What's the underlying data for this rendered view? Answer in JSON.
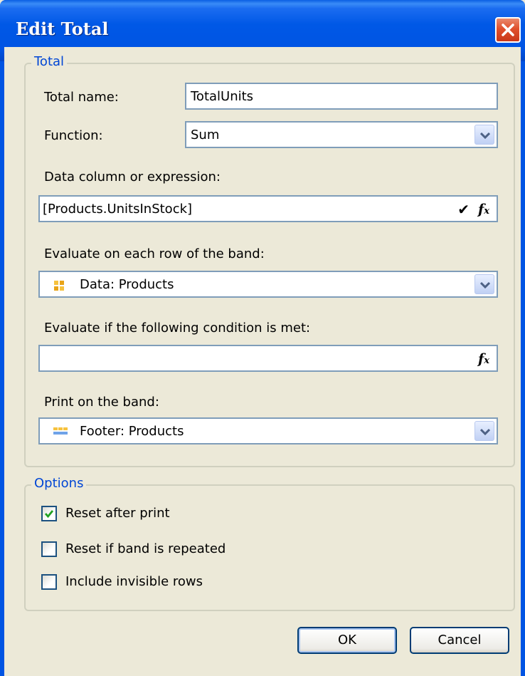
{
  "window": {
    "title": "Edit Total",
    "close_icon": "close-icon"
  },
  "total_group": {
    "legend": "Total",
    "total_name_label": "Total name:",
    "total_name_value": "TotalUnits",
    "function_label": "Function:",
    "function_value": "Sum",
    "data_column_label": "Data column or expression:",
    "data_column_value": "[Products.UnitsInStock]",
    "evaluate_band_label": "Evaluate on each row of the band:",
    "evaluate_band_value": "Data: Products",
    "condition_label": "Evaluate if the following condition is met:",
    "condition_value": "",
    "print_band_label": "Print on the band:",
    "print_band_value": "Footer: Products",
    "fx_label": "fx"
  },
  "options_group": {
    "legend": "Options",
    "reset_after_print": {
      "label": "Reset after print",
      "checked": true
    },
    "reset_if_repeated": {
      "label": "Reset if band is repeated",
      "checked": false
    },
    "include_invisible": {
      "label": "Include invisible rows",
      "checked": false
    }
  },
  "buttons": {
    "ok": "OK",
    "cancel": "Cancel"
  },
  "colors": {
    "title_bar": "#0054e3",
    "legend_text": "#0046d5",
    "close_button": "#e0502c",
    "dialog_bg": "#ece9d8"
  }
}
